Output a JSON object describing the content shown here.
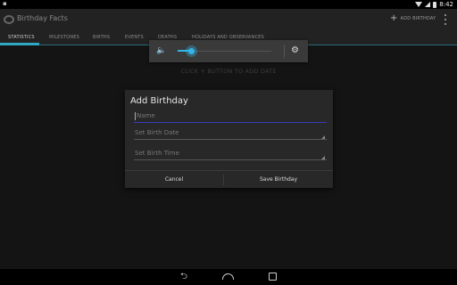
{
  "status": {
    "time": "8:42"
  },
  "app": {
    "title": "Birthday Facts",
    "add_label": "ADD BIRTHDAY"
  },
  "tabs": [
    {
      "label": "STATISTICS"
    },
    {
      "label": "MILESTONES"
    },
    {
      "label": "BIRTHS"
    },
    {
      "label": "EVENTS"
    },
    {
      "label": "DEATHS"
    },
    {
      "label": "HOLIDAYS AND OBSERVANCES"
    }
  ],
  "content": {
    "hint": "CLICK + BUTTON TO ADD DATE"
  },
  "volume": {
    "level": 0.15
  },
  "dialog": {
    "title": "Add Birthday",
    "name_placeholder": "Name",
    "date_label": "Set Birth Date",
    "time_label": "Set Birth Time",
    "cancel_label": "Cancel",
    "save_label": "Save Birthday"
  },
  "icons": {
    "accent": "#33b5e5",
    "names": [
      "wifi-icon",
      "signal-icon",
      "battery-icon",
      "plus-icon",
      "overflow-icon",
      "speaker-icon",
      "settings-icon",
      "back-icon",
      "home-icon",
      "recents-icon"
    ]
  }
}
